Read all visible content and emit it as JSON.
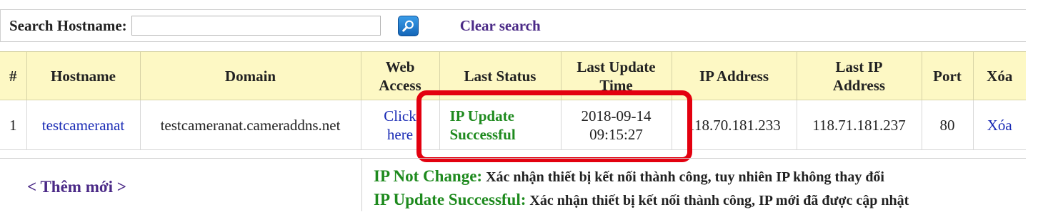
{
  "search": {
    "label": "Search Hostname:",
    "value": "",
    "clear_label": "Clear search"
  },
  "table": {
    "headers": {
      "index": "#",
      "hostname": "Hostname",
      "domain": "Domain",
      "web_access_1": "Web",
      "web_access_2": "Access",
      "last_status": "Last Status",
      "last_update_1": "Last Update",
      "last_update_2": "Time",
      "ip_address": "IP Address",
      "last_ip_1": "Last IP",
      "last_ip_2": "Address",
      "port": "Port",
      "delete": "Xóa"
    },
    "rows": [
      {
        "index": "1",
        "hostname": "testcameranat",
        "domain": "testcameranat.cameraddns.net",
        "web_access_1": "Click",
        "web_access_2": "here",
        "status_1": "IP Update",
        "status_2": "Successful",
        "date": "2018-09-14",
        "time": "09:15:27",
        "ip": "118.70.181.233",
        "last_ip": "118.71.181.237",
        "port": "80",
        "delete": "Xóa"
      }
    ]
  },
  "footer": {
    "add_label": "< Thêm mới >",
    "legend": [
      {
        "key": "IP Not Change:",
        "text": "Xác nhận thiết bị kết nối thành công, tuy nhiên IP không thay đổi"
      },
      {
        "key": "IP Update Successful:",
        "text": "Xác nhận thiết bị kết nối thành công, IP mới đã được cập nhật"
      }
    ]
  },
  "colors": {
    "header_bg": "#fdf8c4",
    "status_green": "#1e8a1e",
    "link_blue": "#1a2bb5",
    "link_purple": "#4b2a87",
    "highlight_red": "#e3000f"
  },
  "icons": {
    "search_button": "magnifier-icon"
  }
}
